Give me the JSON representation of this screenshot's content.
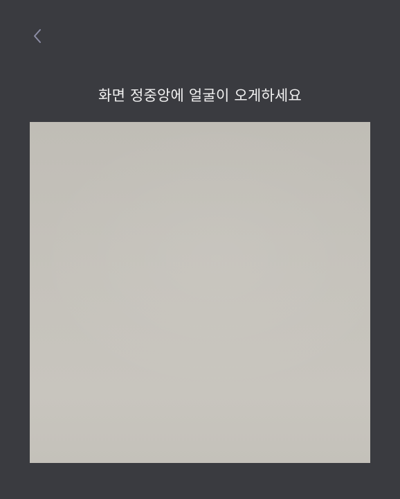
{
  "header": {
    "back_icon": "chevron-left-icon",
    "back_icon_color": "#8d8ea6"
  },
  "instruction_text": "화면 정중앙에 얼굴이 오게하세요",
  "colors": {
    "background": "#3a3b40",
    "text": "#f2f2f2",
    "preview_fill": "#c4c1ba"
  }
}
